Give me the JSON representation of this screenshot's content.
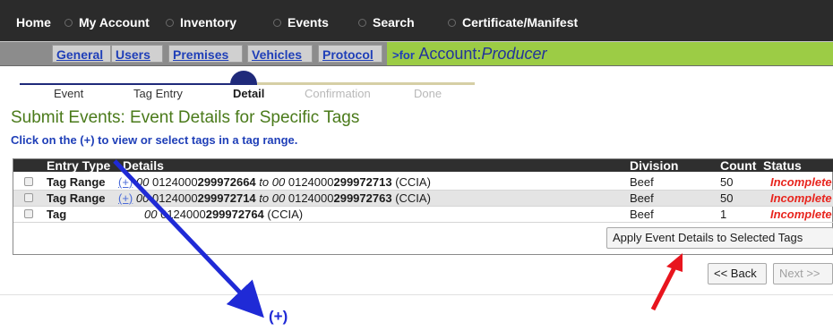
{
  "topnav": {
    "items": [
      {
        "label": "Home"
      },
      {
        "label": "My Account"
      },
      {
        "label": "Inventory"
      },
      {
        "label": "Events"
      },
      {
        "label": "Search"
      },
      {
        "label": "Certificate/Manifest"
      }
    ]
  },
  "subnav": {
    "tabs": [
      {
        "label": "General"
      },
      {
        "label": "Users"
      },
      {
        "label": "Premises"
      },
      {
        "label": "Vehicles"
      },
      {
        "label": "Protocol"
      }
    ],
    "account_prefix": ">for",
    "account_label": "Account:",
    "account_name": "Producer"
  },
  "wizard": {
    "steps": [
      {
        "label": "Event",
        "state": "done"
      },
      {
        "label": "Tag Entry",
        "state": "done"
      },
      {
        "label": "Detail",
        "state": "current"
      },
      {
        "label": "Confirmation",
        "state": "future"
      },
      {
        "label": "Done",
        "state": "future"
      }
    ]
  },
  "page": {
    "title": "Submit Events: Event Details for Specific Tags",
    "instruction": "Click on the (+) to view or select tags in a tag range."
  },
  "table": {
    "headers": {
      "entry_type": "Entry Type",
      "details": "Details",
      "division": "Division",
      "count": "Count",
      "status": "Status"
    },
    "rows": [
      {
        "entry_type": "Tag Range",
        "expand": "(+)",
        "from_prefix": "00",
        "from_num": "0124000",
        "from_bold": "299972664",
        "to_word": "to",
        "to_prefix": "00",
        "to_num": "0124000",
        "to_bold": "299972713",
        "suffix": "(CCIA)",
        "division": "Beef",
        "count": "50",
        "status": "Incomplete"
      },
      {
        "entry_type": "Tag Range",
        "expand": "(+)",
        "from_prefix": "00",
        "from_num": "0124000",
        "from_bold": "299972714",
        "to_word": "to",
        "to_prefix": "00",
        "to_num": "0124000",
        "to_bold": "299972763",
        "suffix": "(CCIA)",
        "division": "Beef",
        "count": "50",
        "status": "Incomplete"
      },
      {
        "entry_type": "Tag",
        "from_prefix": "00",
        "from_num": "0124000",
        "from_bold": "299972764",
        "suffix": "(CCIA)",
        "division": "Beef",
        "count": "1",
        "status": "Incomplete"
      }
    ],
    "apply_button": "Apply Event Details to Selected Tags"
  },
  "footer": {
    "back_button": "<< Back",
    "next_button": "Next >>"
  },
  "annotations": {
    "plus_label": "(+)",
    "blue_arrow_color": "#1f2ad6",
    "red_arrow_color": "#e8151e"
  },
  "colors": {
    "topnav_bg": "#2b2b2b",
    "account_bar": "#9ccc45",
    "link_blue": "#1f3fb8",
    "title_green": "#4a7a1a",
    "status_red": "#e8251e"
  }
}
